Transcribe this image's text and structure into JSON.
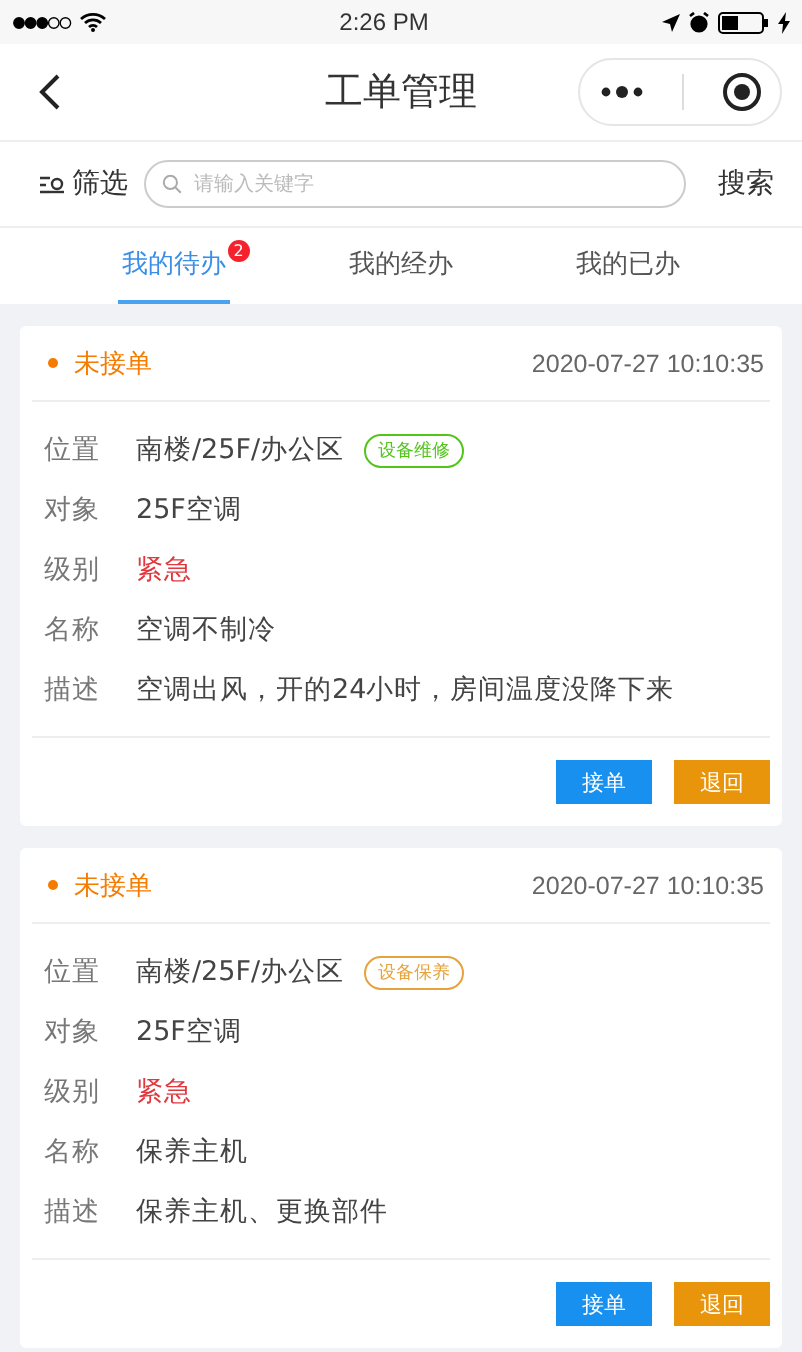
{
  "status_bar": {
    "time": "2:26 PM"
  },
  "nav": {
    "title": "工单管理"
  },
  "search": {
    "filter_label": "筛选",
    "placeholder": "请输入关键字",
    "button": "搜索"
  },
  "tabs": [
    {
      "label": "我的待办",
      "selected": true,
      "badge": "2"
    },
    {
      "label": "我的经办",
      "selected": false
    },
    {
      "label": "我的已办",
      "selected": false
    }
  ],
  "orders": [
    {
      "status": "未接单",
      "time": "2020-07-27 10:10:35",
      "fields": [
        {
          "kind": "tagged",
          "label": "位置",
          "value": "南楼/25F/办公区",
          "tag": "设备维修",
          "color": "#52c41a"
        },
        {
          "kind": "plain",
          "label": "对象",
          "value": "25F空调"
        },
        {
          "kind": "alert",
          "label": "级别",
          "value": "紧急"
        },
        {
          "kind": "plain",
          "label": "名称",
          "value": "空调不制冷"
        },
        {
          "kind": "plain",
          "label": "描述",
          "value": "空调出风，开的24小时，房间温度没降下来"
        }
      ],
      "actions": [
        {
          "kind": "primary",
          "label": "接单"
        },
        {
          "kind": "warning",
          "label": "退回"
        }
      ]
    },
    {
      "status": "未接单",
      "time": "2020-07-27 10:10:35",
      "fields": [
        {
          "kind": "tagged",
          "label": "位置",
          "value": "南楼/25F/办公区",
          "tag": "设备保养",
          "color": "#e6a23c"
        },
        {
          "kind": "plain",
          "label": "对象",
          "value": "25F空调"
        },
        {
          "kind": "alert",
          "label": "级别",
          "value": "紧急"
        },
        {
          "kind": "plain",
          "label": "名称",
          "value": "保养主机"
        },
        {
          "kind": "plain",
          "label": "描述",
          "value": "保养主机、更换部件"
        }
      ],
      "actions": [
        {
          "kind": "primary",
          "label": "接单"
        },
        {
          "kind": "warning",
          "label": "退回"
        }
      ]
    }
  ]
}
